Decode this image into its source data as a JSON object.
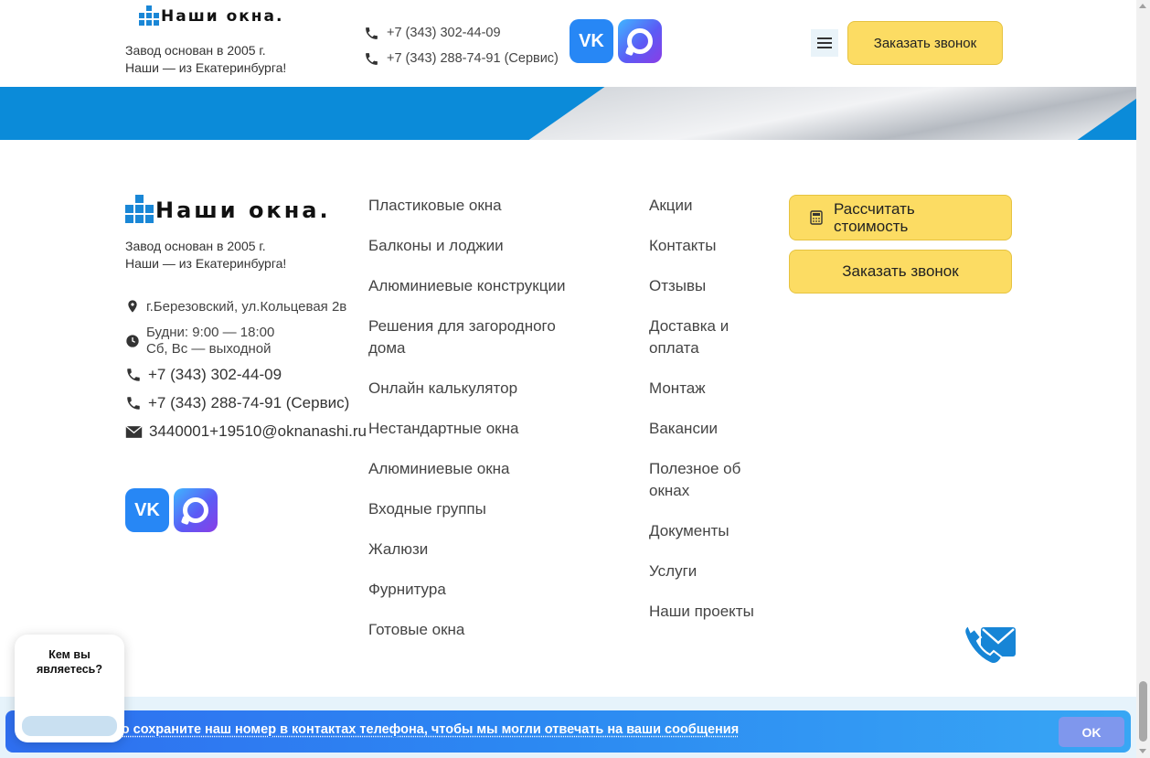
{
  "header": {
    "logo_text": "Наши окна",
    "tagline_line1": "Завод основан в 2005 г.",
    "tagline_line2": "Наши — из Екатеринбурга!",
    "phone1": "+7 (343) 302-44-09",
    "phone2": "+7 (343) 288-74-91 (Сервис)",
    "social_vk_label": "VK",
    "callback_button": "Заказать звонок"
  },
  "footer": {
    "logo_text": "Наши окна",
    "tagline_line1": "Завод основан в 2005 г.",
    "tagline_line2": "Наши — из Екатеринбурга!",
    "address": "г.Березовский, ул.Кольцевая 2в",
    "hours_line1": "Будни: 9:00 — 18:00",
    "hours_line2": "Сб, Вс — выходной",
    "phone1": "+7 (343) 302-44-09",
    "phone2": "+7 (343) 288-74-91 (Сервис)",
    "email": "3440001+19510@oknanashi.ru",
    "social_vk_label": "VK",
    "menu_products": [
      "Пластиковые окна",
      "Балконы и лоджии",
      "Алюминиевые конструкции",
      "Решения для загородного дома",
      "Онлайн калькулятор",
      "Нестандартные окна",
      "Алюминиевые окна",
      "Входные группы",
      "Жалюзи",
      "Фурнитура",
      "Готовые окна"
    ],
    "menu_info": [
      "Акции",
      "Контакты",
      "Отзывы",
      "Доставка и оплата",
      "Монтаж",
      "Вакансии",
      "Полезное об окнах",
      "Документы",
      "Услуги",
      "Наши проекты"
    ],
    "calc_button": "Рассчитать стоимость",
    "callback_button": "Заказать звонок"
  },
  "chat_popup": {
    "question": "Кем вы являетесь?"
  },
  "notice": {
    "text": "но сохраните наш номер в контактах телефона, чтобы мы могли отвечать на ваши сообщения",
    "ok_label": "OK"
  },
  "colors": {
    "brand_blue": "#0b8bd9",
    "button_yellow": "#fcdc63"
  }
}
